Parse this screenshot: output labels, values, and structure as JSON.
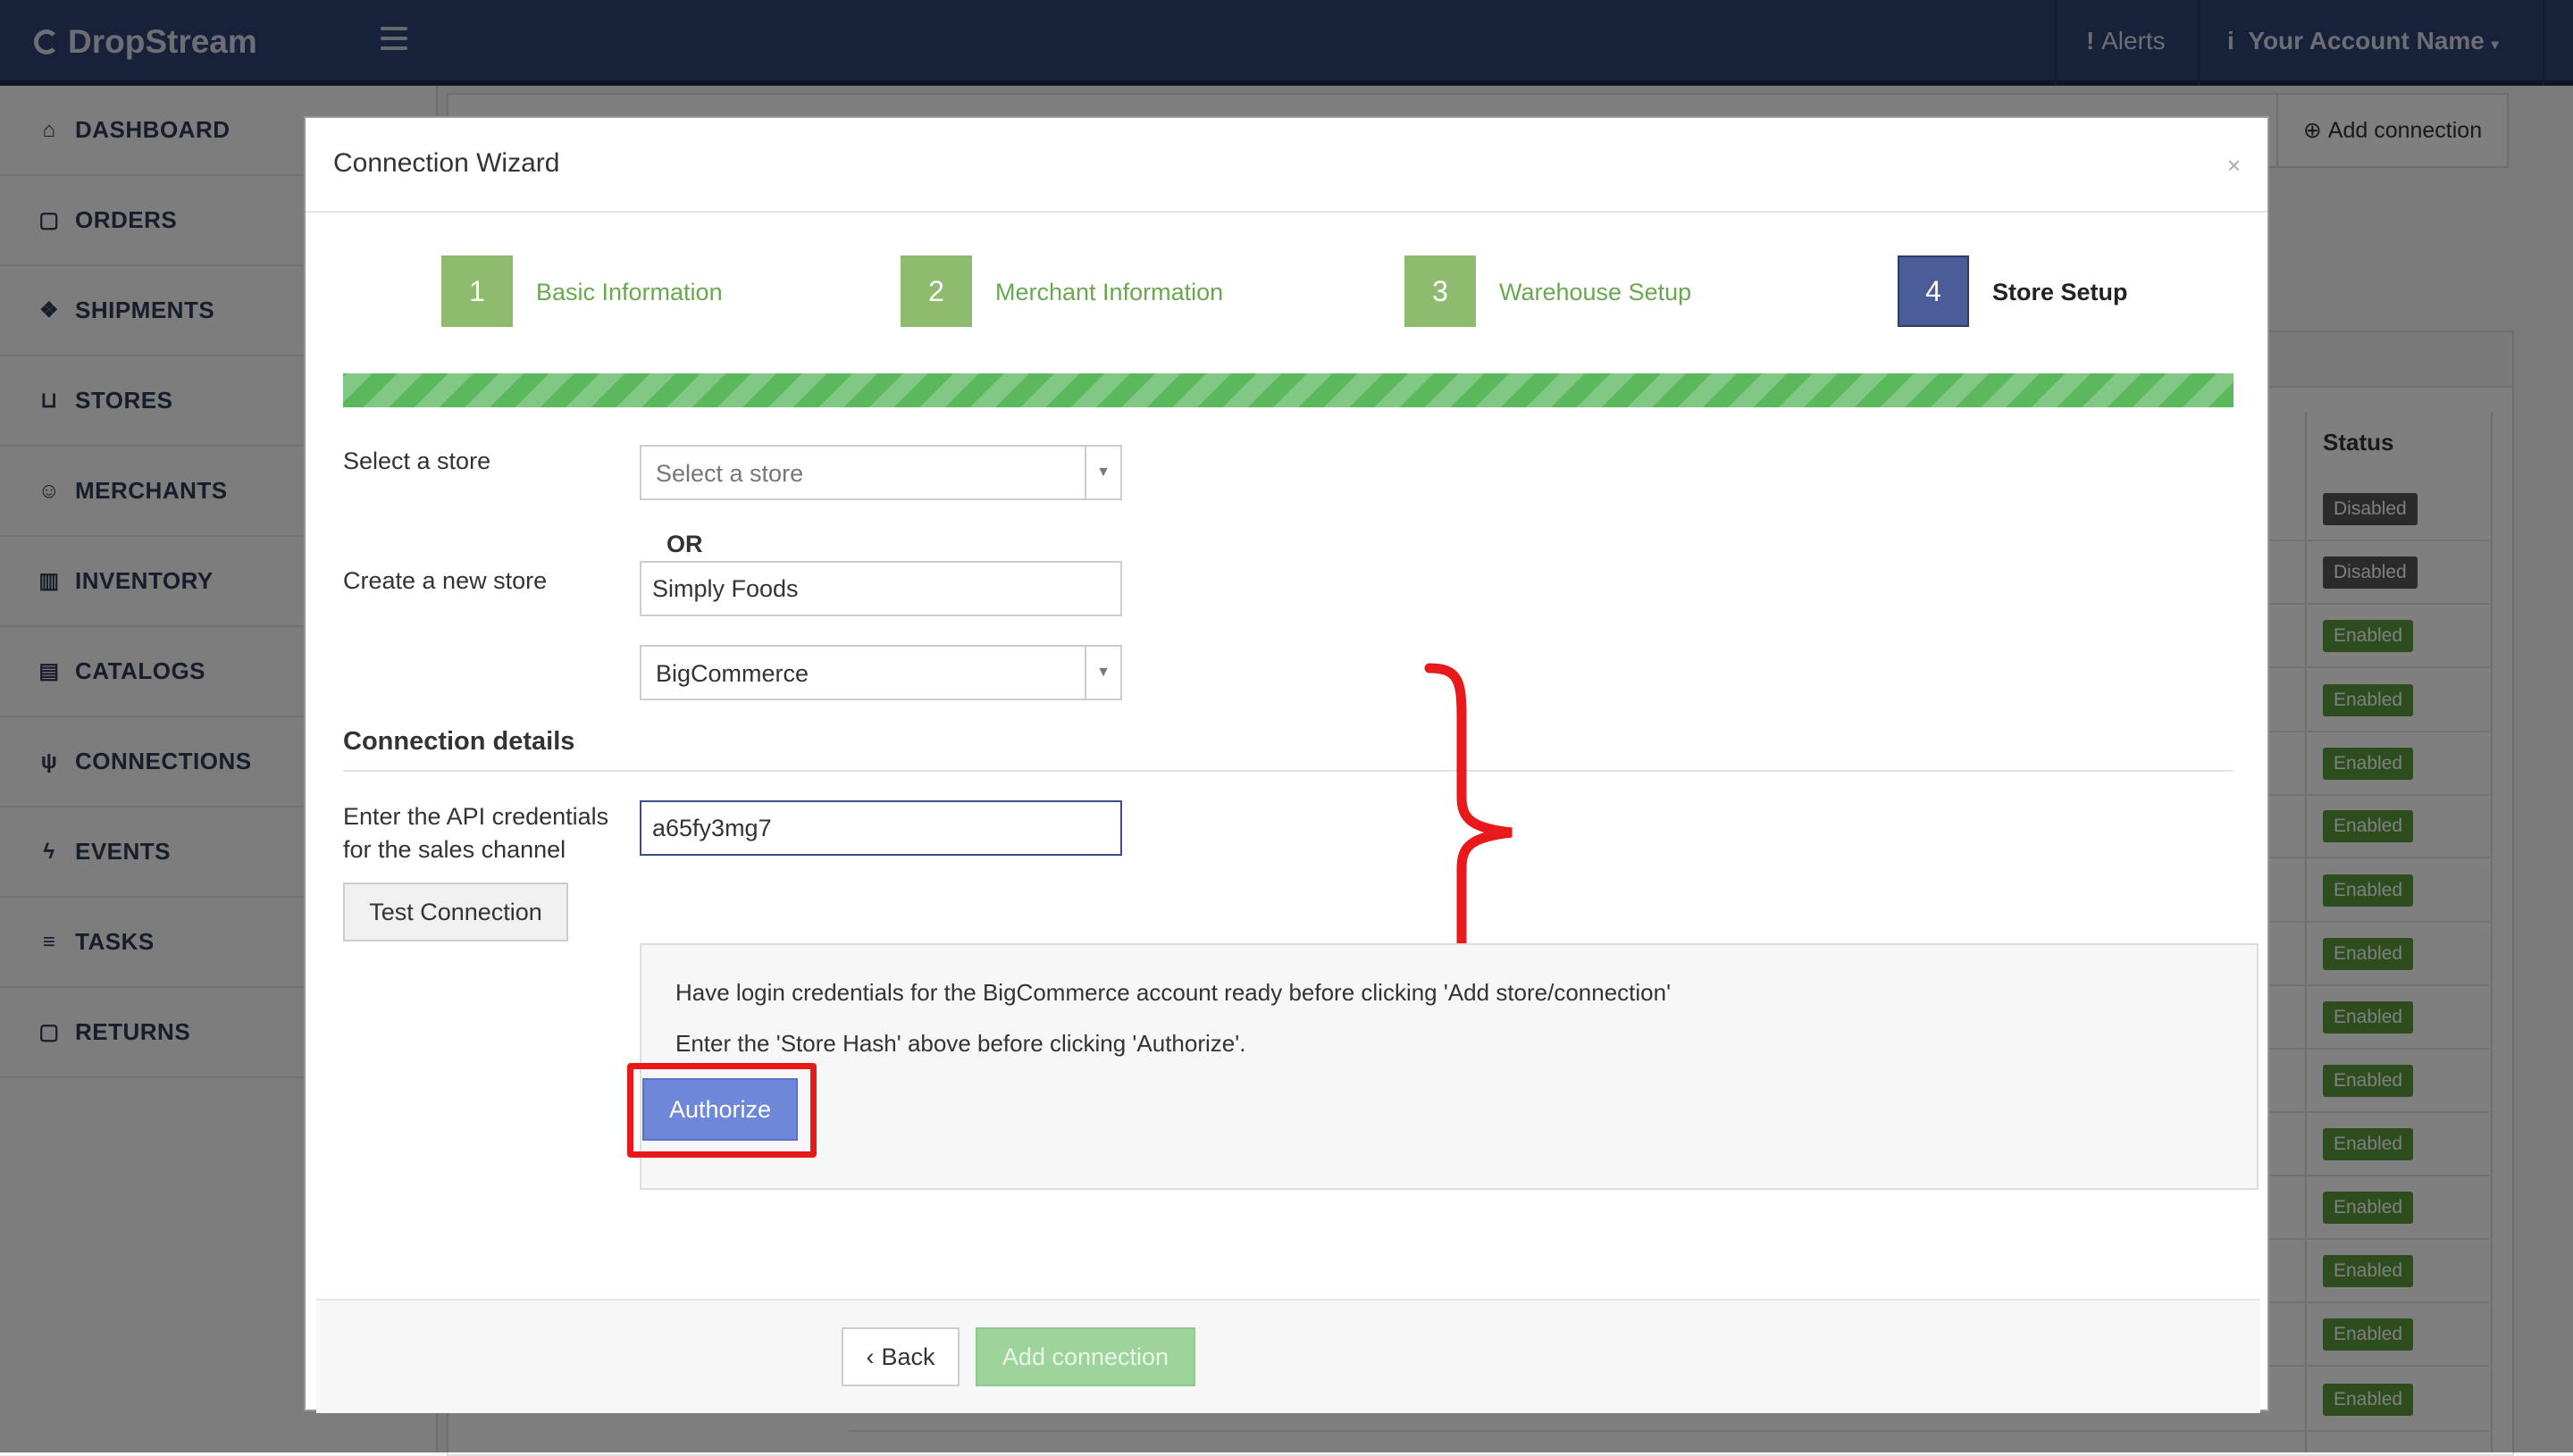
{
  "app": {
    "brand": "DropStream"
  },
  "navbar": {
    "alerts": "Alerts",
    "account": "Your Account Name"
  },
  "sidebar": {
    "items": [
      {
        "label": "DASHBOARD",
        "icon": "home-icon"
      },
      {
        "label": "ORDERS",
        "icon": "bag-icon"
      },
      {
        "label": "SHIPMENTS",
        "icon": "boxes-icon"
      },
      {
        "label": "STORES",
        "icon": "cart-icon"
      },
      {
        "label": "MERCHANTS",
        "icon": "users-icon"
      },
      {
        "label": "INVENTORY",
        "icon": "warehouse-icon"
      },
      {
        "label": "CATALOGS",
        "icon": "book-icon"
      },
      {
        "label": "CONNECTIONS",
        "icon": "plug-icon"
      },
      {
        "label": "EVENTS",
        "icon": "bolt-icon"
      },
      {
        "label": "TASKS",
        "icon": "list-icon"
      },
      {
        "label": "RETURNS",
        "icon": "bag-icon"
      }
    ]
  },
  "background": {
    "add_connection": "Add connection",
    "status_header": "Status",
    "statuses": [
      "Disabled",
      "Disabled",
      "Enabled",
      "Enabled",
      "Enabled",
      "Enabled",
      "Enabled",
      "Enabled",
      "Enabled",
      "Enabled",
      "Enabled",
      "Enabled",
      "Enabled",
      "Enabled",
      "Enabled"
    ]
  },
  "modal": {
    "title": "Connection Wizard",
    "close": "×",
    "steps": [
      {
        "num": "1",
        "label": "Basic Information",
        "state": "done"
      },
      {
        "num": "2",
        "label": "Merchant Information",
        "state": "done"
      },
      {
        "num": "3",
        "label": "Warehouse Setup",
        "state": "done"
      },
      {
        "num": "4",
        "label": "Store Setup",
        "state": "active"
      }
    ],
    "progress": 1.0,
    "select_store_label": "Select a store",
    "select_store_placeholder": "Select a store",
    "or": "OR",
    "create_store_label": "Create a new store",
    "new_store_name": "Simply Foods",
    "platform": "BigCommerce",
    "connection_details_title": "Connection details",
    "api_label_line1": "Enter the API credentials",
    "api_label_line2": "for the sales channel",
    "api_value": "a65fy3mg7",
    "test_button": "Test Connection",
    "info_line1": "Have login credentials for the BigCommerce account ready before clicking 'Add store/connection'",
    "info_line2": "Enter the 'Store Hash' above before clicking 'Authorize'.",
    "authorize_button": "Authorize",
    "back_button": "Back",
    "add_button": "Add connection"
  },
  "colors": {
    "navbar": "#2e4272",
    "step_done": "#8fbb6e",
    "step_active": "#4a5d96",
    "progress": "#5cb85c",
    "authorize": "#6f87d8",
    "highlight": "#e8191a"
  }
}
